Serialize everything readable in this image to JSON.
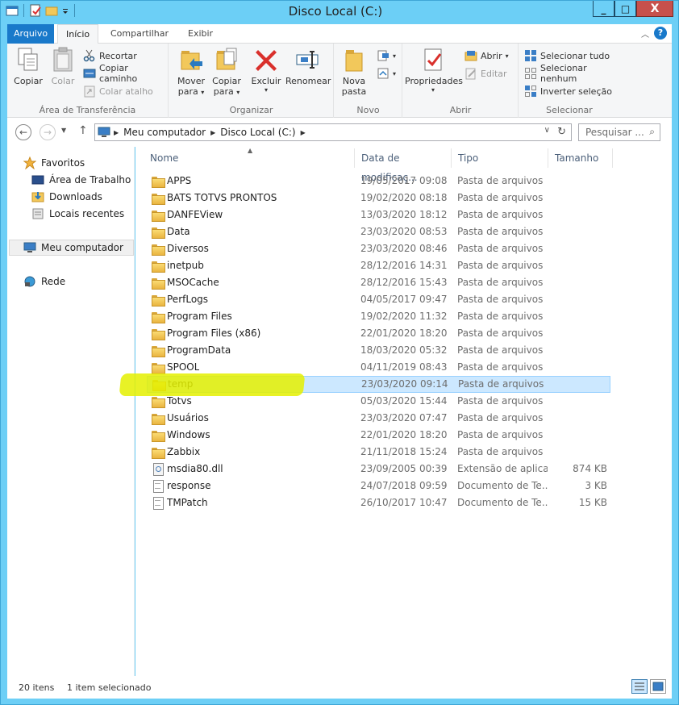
{
  "window": {
    "title": "Disco Local (C:)",
    "minimize": "_",
    "maximize": "□",
    "close": "X"
  },
  "ribbon_tabs": {
    "file": "Arquivo",
    "home": "Início",
    "share": "Compartilhar",
    "view": "Exibir",
    "help": "?"
  },
  "ribbon": {
    "clipboard": {
      "label": "Área de Transferência",
      "copy": "Copiar",
      "paste": "Colar",
      "cut": "Recortar",
      "copy_path": "Copiar caminho",
      "paste_shortcut": "Colar atalho"
    },
    "organize": {
      "label": "Organizar",
      "move_to": "Mover",
      "move_to_2": "para",
      "copy_to": "Copiar",
      "copy_to_2": "para",
      "delete": "Excluir",
      "rename": "Renomear"
    },
    "new": {
      "label": "Novo",
      "new_folder": "Nova",
      "new_folder_2": "pasta"
    },
    "open": {
      "label": "Abrir",
      "properties": "Propriedades",
      "open": "Abrir",
      "edit": "Editar"
    },
    "select": {
      "label": "Selecionar",
      "select_all": "Selecionar tudo",
      "select_none": "Selecionar nenhum",
      "invert": "Inverter seleção"
    }
  },
  "address": {
    "root": "Meu computador",
    "current": "Disco Local (C:)",
    "search_placeholder": "Pesquisar ..."
  },
  "nav": {
    "favorites": "Favoritos",
    "desktop": "Área de Trabalho",
    "downloads": "Downloads",
    "recent": "Locais recentes",
    "computer": "Meu computador",
    "network": "Rede"
  },
  "columns": {
    "name": "Nome",
    "date": "Data de modificaç...",
    "type": "Tipo",
    "size": "Tamanho"
  },
  "files": [
    {
      "name": "APPS",
      "date": "19/05/2017 09:08",
      "type": "Pasta de arquivos",
      "size": "",
      "icon": "folder"
    },
    {
      "name": "BATS TOTVS PRONTOS",
      "date": "19/02/2020 08:18",
      "type": "Pasta de arquivos",
      "size": "",
      "icon": "folder"
    },
    {
      "name": "DANFEView",
      "date": "13/03/2020 18:12",
      "type": "Pasta de arquivos",
      "size": "",
      "icon": "folder"
    },
    {
      "name": "Data",
      "date": "23/03/2020 08:53",
      "type": "Pasta de arquivos",
      "size": "",
      "icon": "folder"
    },
    {
      "name": "Diversos",
      "date": "23/03/2020 08:46",
      "type": "Pasta de arquivos",
      "size": "",
      "icon": "folder"
    },
    {
      "name": "inetpub",
      "date": "28/12/2016 14:31",
      "type": "Pasta de arquivos",
      "size": "",
      "icon": "folder"
    },
    {
      "name": "MSOCache",
      "date": "28/12/2016 15:43",
      "type": "Pasta de arquivos",
      "size": "",
      "icon": "folder"
    },
    {
      "name": "PerfLogs",
      "date": "04/05/2017 09:47",
      "type": "Pasta de arquivos",
      "size": "",
      "icon": "folder"
    },
    {
      "name": "Program Files",
      "date": "19/02/2020 11:32",
      "type": "Pasta de arquivos",
      "size": "",
      "icon": "folder"
    },
    {
      "name": "Program Files (x86)",
      "date": "22/01/2020 18:20",
      "type": "Pasta de arquivos",
      "size": "",
      "icon": "folder"
    },
    {
      "name": "ProgramData",
      "date": "18/03/2020 05:32",
      "type": "Pasta de arquivos",
      "size": "",
      "icon": "folder"
    },
    {
      "name": "SPOOL",
      "date": "04/11/2019 08:43",
      "type": "Pasta de arquivos",
      "size": "",
      "icon": "folder"
    },
    {
      "name": "temp",
      "date": "23/03/2020 09:14",
      "type": "Pasta de arquivos",
      "size": "",
      "icon": "folder",
      "selected": true
    },
    {
      "name": "Totvs",
      "date": "05/03/2020 15:44",
      "type": "Pasta de arquivos",
      "size": "",
      "icon": "folder"
    },
    {
      "name": "Usuários",
      "date": "23/03/2020 07:47",
      "type": "Pasta de arquivos",
      "size": "",
      "icon": "folder"
    },
    {
      "name": "Windows",
      "date": "22/01/2020 18:20",
      "type": "Pasta de arquivos",
      "size": "",
      "icon": "folder"
    },
    {
      "name": "Zabbix",
      "date": "21/11/2018 15:24",
      "type": "Pasta de arquivos",
      "size": "",
      "icon": "folder"
    },
    {
      "name": "msdia80.dll",
      "date": "23/09/2005 00:39",
      "type": "Extensão de aplica...",
      "size": "874 KB",
      "icon": "dll"
    },
    {
      "name": "response",
      "date": "24/07/2018 09:59",
      "type": "Documento de Te...",
      "size": "3 KB",
      "icon": "doc"
    },
    {
      "name": "TMPatch",
      "date": "26/10/2017 10:47",
      "type": "Documento de Te...",
      "size": "15 KB",
      "icon": "doc"
    }
  ],
  "status": {
    "count": "20 itens",
    "selected": "1 item selecionado"
  },
  "colors": {
    "titlebar": "#6ccff6",
    "accent": "#1979ca",
    "selection": "#cce8ff",
    "highlight": "#e4f000"
  }
}
